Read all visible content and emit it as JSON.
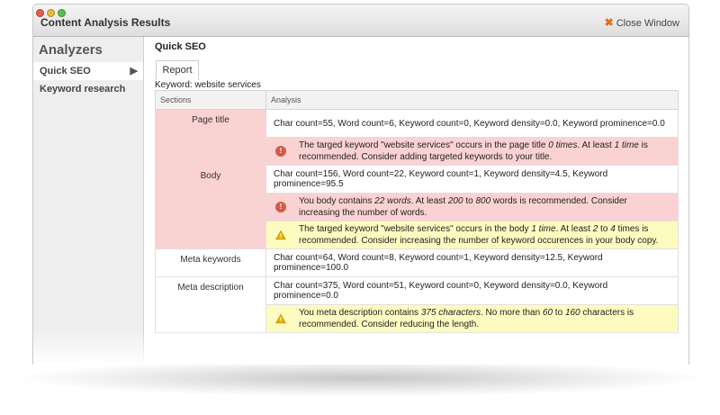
{
  "window": {
    "title": "Content Analysis Results",
    "close_label": "Close Window"
  },
  "sidebar": {
    "heading": "Analyzers",
    "items": [
      {
        "label": "Quick SEO",
        "active": true
      },
      {
        "label": "Keyword research",
        "active": false
      }
    ]
  },
  "main": {
    "section_title": "Quick SEO",
    "tab_label": "Report",
    "keyword_label": "Keyword: website services",
    "table": {
      "headers": [
        "Sections",
        "Analysis"
      ],
      "rows": [
        {
          "section": "Page title",
          "stats": "Char count=55, Word count=6, Keyword count=0, Keyword density=0.0, Keyword prominence=0.0",
          "messages": [
            {
              "type": "error",
              "parts": [
                "The targed keyword \"website services\" occurs in the page title ",
                "0 times",
                ". At least ",
                "1 time",
                " is recommended. Consider adding targeted keywords to your title."
              ]
            }
          ]
        },
        {
          "section": "Body",
          "stats": "Char count=156, Word count=22, Keyword count=1, Keyword density=4.5, Keyword prominence=95.5",
          "messages": [
            {
              "type": "error",
              "parts": [
                "You body contains ",
                "22 words",
                ". At least ",
                "200",
                " to ",
                "800",
                " words is recommended. Consider increasing the number of words."
              ]
            },
            {
              "type": "warning",
              "parts": [
                "The targed keyword \"website services\" occurs in the body ",
                "1 time",
                ". At least ",
                "2",
                " to ",
                "4",
                " times is recommended. Consider increasing the number of keyword occurences in your body copy."
              ]
            }
          ]
        },
        {
          "section": "Meta keywords",
          "stats": "Char count=64, Word count=8, Keyword count=1, Keyword density=12.5, Keyword prominence=100.0",
          "messages": []
        },
        {
          "section": "Meta description",
          "stats": "Char count=375, Word count=51, Keyword count=0, Keyword density=0.0, Keyword prominence=0.0",
          "messages": [
            {
              "type": "warning",
              "parts": [
                "You meta description contains ",
                "375 characters",
                ". No more than ",
                "60",
                " to ",
                "160",
                " characters is recommended. Consider reducing the length."
              ]
            }
          ]
        }
      ]
    }
  },
  "colors": {
    "error_bg": "#fbd2d2",
    "warning_bg": "#fdfbc0",
    "error_icon": "#d35a46",
    "warning_icon": "#e2b200",
    "close_icon": "#e07020"
  },
  "icons": {
    "error": "exclamation-circle-icon",
    "warning": "warning-triangle-icon",
    "close": "close-x-icon"
  }
}
